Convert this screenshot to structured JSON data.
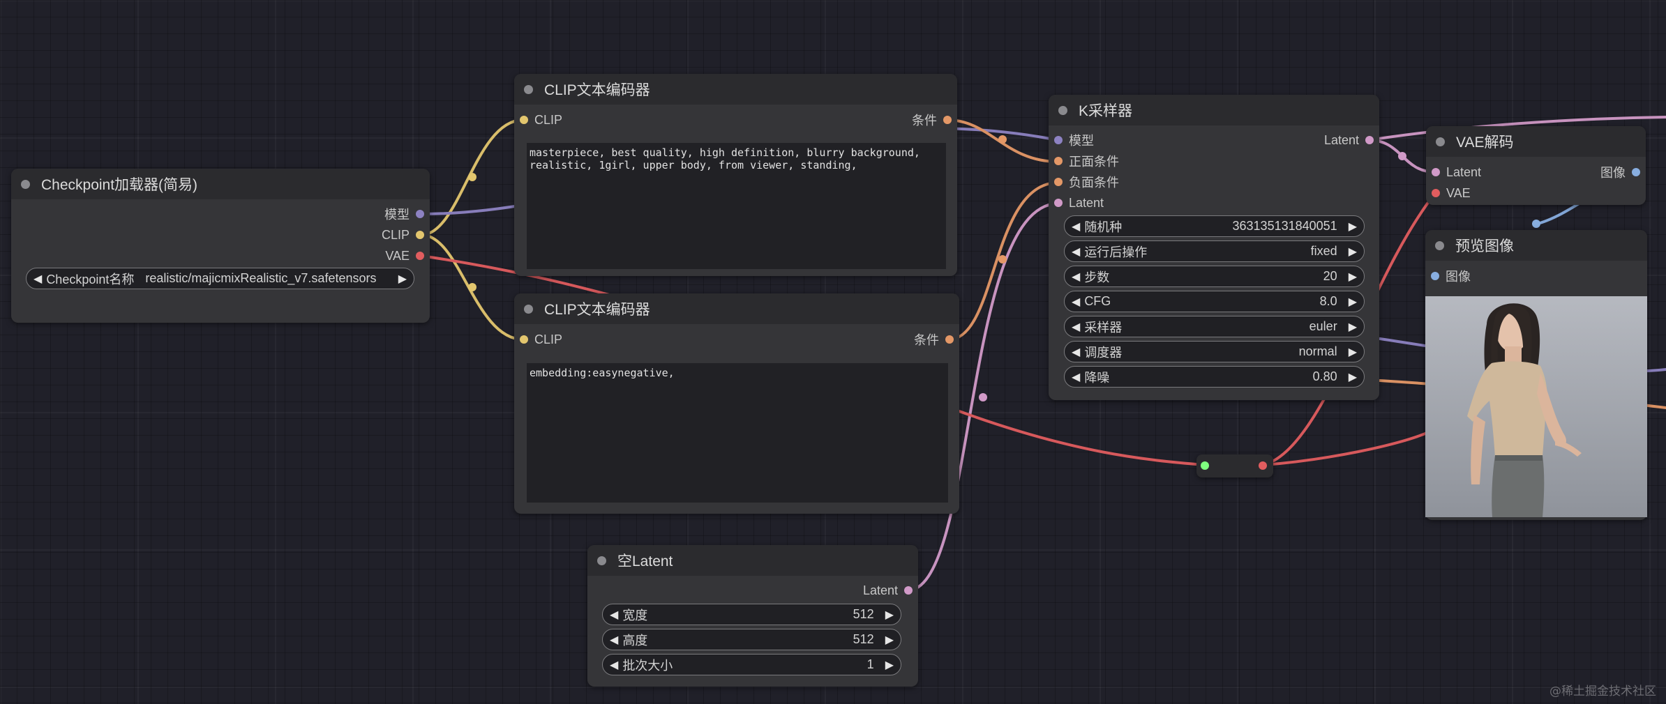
{
  "colors": {
    "clip": "#e3c66e",
    "model": "#8d82c2",
    "vae": "#e15d5f",
    "conditioning": "#e49867",
    "latent": "#d19ac8",
    "image": "#88aee0",
    "reroute_in": "#7fff7f"
  },
  "nodes": {
    "checkpoint": {
      "title": "Checkpoint加载器(简易)",
      "outputs": [
        "模型",
        "CLIP",
        "VAE"
      ],
      "widget_label": "Checkpoint名称",
      "widget_value": "realistic/majicmixRealistic_v7.safetensors"
    },
    "clip_pos": {
      "title": "CLIP文本编码器",
      "input": "CLIP",
      "output": "条件",
      "text": "masterpiece, best quality, high definition, blurry background, realistic, 1girl, upper body, from viewer, standing,"
    },
    "clip_neg": {
      "title": "CLIP文本编码器",
      "input": "CLIP",
      "output": "条件",
      "text": "embedding:easynegative,"
    },
    "ksampler": {
      "title": "K采样器",
      "inputs": [
        "模型",
        "正面条件",
        "负面条件",
        "Latent"
      ],
      "output": "Latent",
      "widgets": [
        {
          "label": "随机种",
          "value": "363135131840051"
        },
        {
          "label": "运行后操作",
          "value": "fixed"
        },
        {
          "label": "步数",
          "value": "20"
        },
        {
          "label": "CFG",
          "value": "8.0"
        },
        {
          "label": "采样器",
          "value": "euler"
        },
        {
          "label": "调度器",
          "value": "normal"
        },
        {
          "label": "降噪",
          "value": "0.80"
        }
      ]
    },
    "vae_decode": {
      "title": "VAE解码",
      "inputs": [
        "Latent",
        "VAE"
      ],
      "output": "图像"
    },
    "preview": {
      "title": "预览图像",
      "input": "图像"
    },
    "empty_latent": {
      "title": "空Latent",
      "output": "Latent",
      "widgets": [
        {
          "label": "宽度",
          "value": "512"
        },
        {
          "label": "高度",
          "value": "512"
        },
        {
          "label": "批次大小",
          "value": "1"
        }
      ]
    }
  },
  "watermark": "@稀土掘金技术社区"
}
